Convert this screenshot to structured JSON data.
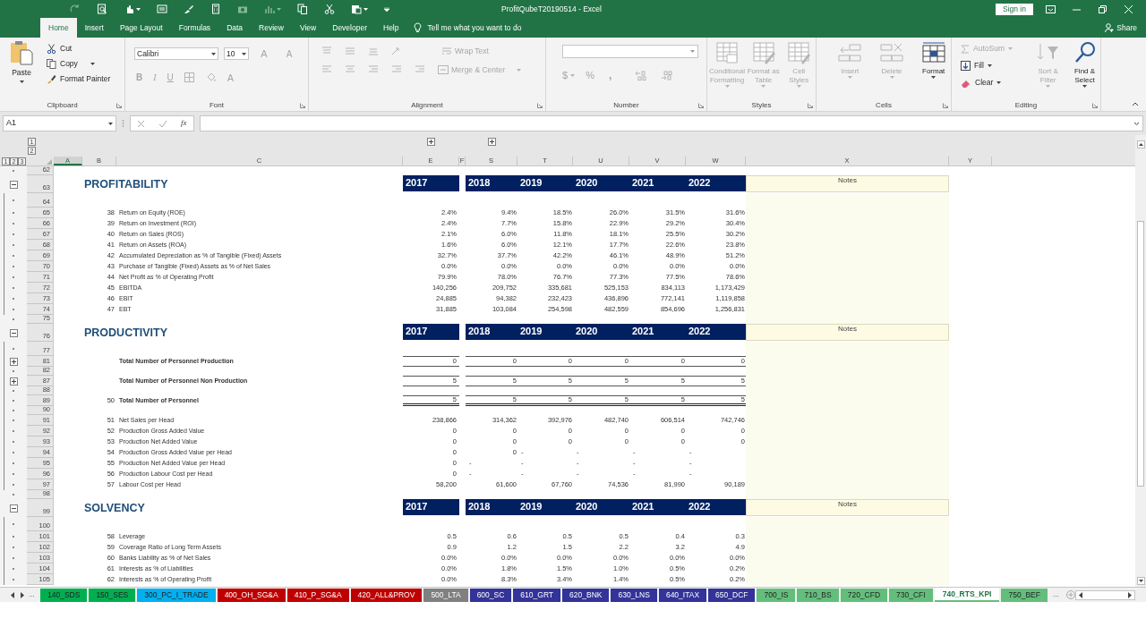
{
  "window": {
    "title": "ProfitQubeT20190514  -  Excel",
    "sign_in": "Sign in"
  },
  "ribbon_tabs": [
    {
      "label": "Home",
      "selected": true
    },
    {
      "label": "Insert",
      "selected": false
    },
    {
      "label": "Page Layout",
      "selected": false
    },
    {
      "label": "Formulas",
      "selected": false
    },
    {
      "label": "Data",
      "selected": false
    },
    {
      "label": "Review",
      "selected": false
    },
    {
      "label": "View",
      "selected": false
    },
    {
      "label": "Developer",
      "selected": false
    },
    {
      "label": "Help",
      "selected": false
    }
  ],
  "tell_me": "Tell me what you want to do",
  "share": "Share",
  "ribbon": {
    "clipboard": {
      "label": "Clipboard",
      "paste": "Paste",
      "cut": "Cut",
      "copy": "Copy",
      "format_painter": "Format Painter"
    },
    "font": {
      "label": "Font",
      "font_name": "Calibri",
      "font_size": "10",
      "grow": "A",
      "shrink": "A",
      "bold": "B",
      "italic": "I",
      "underline": "U",
      "font_color": "A",
      "disabled": true
    },
    "alignment": {
      "label": "Alignment",
      "wrap_text": "Wrap Text",
      "merge_center": "Merge & Center",
      "disabled": true
    },
    "number": {
      "label": "Number",
      "currency": "$",
      "percent": "%",
      "comma": ",",
      "disabled": true
    },
    "styles": {
      "label": "Styles",
      "buttons": [
        {
          "label": "Conditional Formatting",
          "disabled": true
        },
        {
          "label": "Format as Table",
          "disabled": true
        },
        {
          "label": "Cell Styles",
          "disabled": true
        }
      ]
    },
    "cells": {
      "label": "Cells",
      "buttons": [
        {
          "label": "Insert",
          "disabled": true
        },
        {
          "label": "Delete",
          "disabled": true
        },
        {
          "label": "Format",
          "disabled": false
        }
      ]
    },
    "editing": {
      "label": "Editing",
      "small": [
        {
          "label": "AutoSum",
          "disabled": true
        },
        {
          "label": "Fill",
          "disabled": false
        },
        {
          "label": "Clear",
          "disabled": false
        }
      ],
      "large": [
        {
          "label": "Sort & Filter",
          "disabled": true
        },
        {
          "label": "Find & Select",
          "disabled": false
        }
      ]
    }
  },
  "formula_bar": {
    "name_box": "A1",
    "function_label": "fx"
  },
  "outline": {
    "column_levels": [
      "1",
      "2"
    ],
    "row_levels": [
      "1",
      "2",
      "3"
    ]
  },
  "columns": [
    {
      "label": "A",
      "selected": true
    },
    {
      "label": "B",
      "selected": false
    },
    {
      "label": "C",
      "selected": false
    },
    {
      "label": "E",
      "selected": false,
      "outline_expanded": false
    },
    {
      "label": "F",
      "selected": false
    },
    {
      "label": "S",
      "selected": false,
      "outline_expanded": false
    },
    {
      "label": "T",
      "selected": false
    },
    {
      "label": "U",
      "selected": false
    },
    {
      "label": "V",
      "selected": false
    },
    {
      "label": "W",
      "selected": false
    },
    {
      "label": "X",
      "selected": false
    },
    {
      "label": "Y",
      "selected": false
    }
  ],
  "rows": [
    {
      "row": "62",
      "kind": "blank"
    },
    {
      "row": "63",
      "kind": "header",
      "title": "PROFITABILITY",
      "years": [
        "2017",
        "2018",
        "2019",
        "2020",
        "2021",
        "2022"
      ],
      "notes": "Notes",
      "outline_expanded": true
    },
    {
      "row": "64",
      "kind": "blank"
    },
    {
      "row": "65",
      "kind": "data",
      "number": "38",
      "label": "Return on Equity (ROE)",
      "values": [
        "2.4%",
        "9.4%",
        "18.5%",
        "26.0%",
        "31.5%",
        "31.6%"
      ]
    },
    {
      "row": "66",
      "kind": "data",
      "number": "39",
      "label": "Return on Investment (ROI)",
      "values": [
        "2.4%",
        "7.7%",
        "15.8%",
        "22.9%",
        "29.2%",
        "30.4%"
      ]
    },
    {
      "row": "67",
      "kind": "data",
      "number": "40",
      "label": "Return on Sales (ROS)",
      "values": [
        "2.1%",
        "6.0%",
        "11.8%",
        "18.1%",
        "25.5%",
        "30.2%"
      ]
    },
    {
      "row": "68",
      "kind": "data",
      "number": "41",
      "label": "Return on Assets (ROA)",
      "values": [
        "1.6%",
        "6.0%",
        "12.1%",
        "17.7%",
        "22.6%",
        "23.8%"
      ]
    },
    {
      "row": "69",
      "kind": "data",
      "number": "42",
      "label": "Accumulated Depreciation as % of Tangible (Fixed) Assets",
      "values": [
        "32.7%",
        "37.7%",
        "42.2%",
        "46.1%",
        "48.9%",
        "51.2%"
      ]
    },
    {
      "row": "70",
      "kind": "data",
      "number": "43",
      "label": "Purchase of Tangible (Fixed) Assets as % of Net Sales",
      "values": [
        "0.0%",
        "0.0%",
        "0.0%",
        "0.0%",
        "0.0%",
        "0.0%"
      ]
    },
    {
      "row": "71",
      "kind": "data",
      "number": "44",
      "label": "Net Profit as % of Operating Profit",
      "values": [
        "79.9%",
        "78.0%",
        "76.7%",
        "77.3%",
        "77.5%",
        "78.6%"
      ]
    },
    {
      "row": "72",
      "kind": "data",
      "number": "45",
      "label": "EBITDA",
      "values": [
        "140,256",
        "209,752",
        "335,681",
        "525,153",
        "834,113",
        "1,173,429"
      ]
    },
    {
      "row": "73",
      "kind": "data",
      "number": "46",
      "label": "EBIT",
      "values": [
        "24,885",
        "94,382",
        "232,423",
        "436,896",
        "772,141",
        "1,119,858"
      ]
    },
    {
      "row": "74",
      "kind": "data",
      "number": "47",
      "label": "EBT",
      "values": [
        "31,885",
        "103,084",
        "254,598",
        "482,559",
        "854,696",
        "1,256,831"
      ]
    },
    {
      "row": "75",
      "kind": "blank"
    },
    {
      "row": "76",
      "kind": "header",
      "title": "PRODUCTIVITY",
      "years": [
        "2017",
        "2018",
        "2019",
        "2020",
        "2021",
        "2022"
      ],
      "notes": "Notes",
      "outline_expanded": true
    },
    {
      "row": "77",
      "kind": "blank"
    },
    {
      "row": "81",
      "kind": "total",
      "label": "Total Number of Personnel Production",
      "values": [
        "0",
        "0",
        "0",
        "0",
        "0",
        "0"
      ],
      "double_underline": false,
      "outline_expanded": false
    },
    {
      "row": "82",
      "kind": "blank"
    },
    {
      "row": "87",
      "kind": "total",
      "label": "Total Number of Personnel Non Production",
      "values": [
        "5",
        "5",
        "5",
        "5",
        "5",
        "5"
      ],
      "double_underline": false,
      "outline_expanded": false
    },
    {
      "row": "88",
      "kind": "blank"
    },
    {
      "row": "89",
      "kind": "total",
      "number": "50",
      "label": "Total Number of Personnel",
      "values": [
        "5",
        "5",
        "5",
        "5",
        "5",
        "5"
      ],
      "double_underline": true
    },
    {
      "row": "90",
      "kind": "blank"
    },
    {
      "row": "91",
      "kind": "data",
      "number": "51",
      "label": "Net Sales per Head",
      "values": [
        "238,866",
        "314,362",
        "392,976",
        "482,740",
        "606,514",
        "742,746"
      ]
    },
    {
      "row": "92",
      "kind": "data",
      "number": "52",
      "label": "Production Gross Added Value",
      "values": [
        "0",
        "0",
        "0",
        "0",
        "0",
        "0"
      ]
    },
    {
      "row": "93",
      "kind": "data",
      "number": "53",
      "label": "Production Net Added Value",
      "values": [
        "0",
        "0",
        "0",
        "0",
        "0",
        "0"
      ]
    },
    {
      "row": "94",
      "kind": "data",
      "number": "54",
      "label": "Production Gross Added Value per Head",
      "values": [
        "0",
        "0",
        {
          "kind": "nil",
          "text": "-"
        },
        {
          "kind": "nil",
          "text": "-"
        },
        {
          "kind": "nil",
          "text": "-"
        },
        {
          "kind": "nil",
          "text": "-"
        }
      ]
    },
    {
      "row": "95",
      "kind": "data",
      "number": "55",
      "label": "Production Net Added Value per Head",
      "values": [
        "0",
        {
          "kind": "nil",
          "text": "-"
        },
        {
          "kind": "nil",
          "text": "-"
        },
        {
          "kind": "nil",
          "text": "-"
        },
        {
          "kind": "nil",
          "text": "-"
        },
        {
          "kind": "nil",
          "text": "-"
        }
      ]
    },
    {
      "row": "96",
      "kind": "data",
      "number": "56",
      "label": "Production Labour Cost per Head",
      "values": [
        "0",
        {
          "kind": "nil",
          "text": "-"
        },
        {
          "kind": "nil",
          "text": "-"
        },
        {
          "kind": "nil",
          "text": "-"
        },
        {
          "kind": "nil",
          "text": "-"
        },
        {
          "kind": "nil",
          "text": "-"
        }
      ]
    },
    {
      "row": "97",
      "kind": "data",
      "number": "57",
      "label": "Labour Cost per Head",
      "values": [
        "58,200",
        "61,600",
        "67,760",
        "74,536",
        "81,990",
        "90,189"
      ]
    },
    {
      "row": "98",
      "kind": "blank"
    },
    {
      "row": "99",
      "kind": "header",
      "title": "SOLVENCY",
      "years": [
        "2017",
        "2018",
        "2019",
        "2020",
        "2021",
        "2022"
      ],
      "notes": "Notes",
      "outline_expanded": true
    },
    {
      "row": "100",
      "kind": "blank"
    },
    {
      "row": "101",
      "kind": "data",
      "number": "58",
      "label": "Leverage",
      "values": [
        "0.5",
        "0.6",
        "0.5",
        "0.5",
        "0.4",
        "0.3"
      ]
    },
    {
      "row": "102",
      "kind": "data",
      "number": "59",
      "label": "Coverage Ratio of Long Term Assets",
      "values": [
        "0.9",
        "1.2",
        "1.5",
        "2.2",
        "3.2",
        "4.9"
      ]
    },
    {
      "row": "103",
      "kind": "data",
      "number": "60",
      "label": "Banks Liability as % of Net Sales",
      "values": [
        "0.0%",
        "0.0%",
        "0.0%",
        "0.0%",
        "0.0%",
        "0.0%"
      ]
    },
    {
      "row": "104",
      "kind": "data",
      "number": "61",
      "label": "Interests as % of Liabilities",
      "values": [
        "0.0%",
        "1.8%",
        "1.5%",
        "1.0%",
        "0.5%",
        "0.2%"
      ]
    },
    {
      "row": "105",
      "kind": "data",
      "number": "62",
      "label": "Interests as % of Operating Profit",
      "values": [
        "0.0%",
        "8.3%",
        "3.4%",
        "1.4%",
        "0.5%",
        "0.2%"
      ]
    }
  ],
  "sheet_tabs": [
    {
      "label": "140_SDS",
      "color": "#00b050",
      "selected": false
    },
    {
      "label": "150_SES",
      "color": "#00b050",
      "selected": false
    },
    {
      "label": "300_PC_I_TRADE",
      "color": "#00b0f0",
      "selected": false
    },
    {
      "label": "400_OH_SG&A",
      "color": "#c00000",
      "selected": false
    },
    {
      "label": "410_P_SG&A",
      "color": "#c00000",
      "selected": false
    },
    {
      "label": "420_ALL&PROV",
      "color": "#c00000",
      "selected": false
    },
    {
      "label": "500_LTA",
      "color": "#808080",
      "selected": false
    },
    {
      "label": "600_SC",
      "color": "#333399",
      "selected": false
    },
    {
      "label": "610_GRT",
      "color": "#333399",
      "selected": false
    },
    {
      "label": "620_BNK",
      "color": "#333399",
      "selected": false
    },
    {
      "label": "630_LNS",
      "color": "#333399",
      "selected": false
    },
    {
      "label": "640_ITAX",
      "color": "#333399",
      "selected": false
    },
    {
      "label": "650_DCF",
      "color": "#333399",
      "selected": false
    },
    {
      "label": "700_IS",
      "color": "#63be7b",
      "selected": false
    },
    {
      "label": "710_BS",
      "color": "#63be7b",
      "selected": false
    },
    {
      "label": "720_CFD",
      "color": "#63be7b",
      "selected": false
    },
    {
      "label": "730_CFI",
      "color": "#63be7b",
      "selected": false
    },
    {
      "label": "740_RTS_KPI",
      "color": "#63be7b",
      "selected": true
    },
    {
      "label": "750_BEF",
      "color": "#63be7b",
      "selected": false
    }
  ],
  "tab_overflow": "..."
}
